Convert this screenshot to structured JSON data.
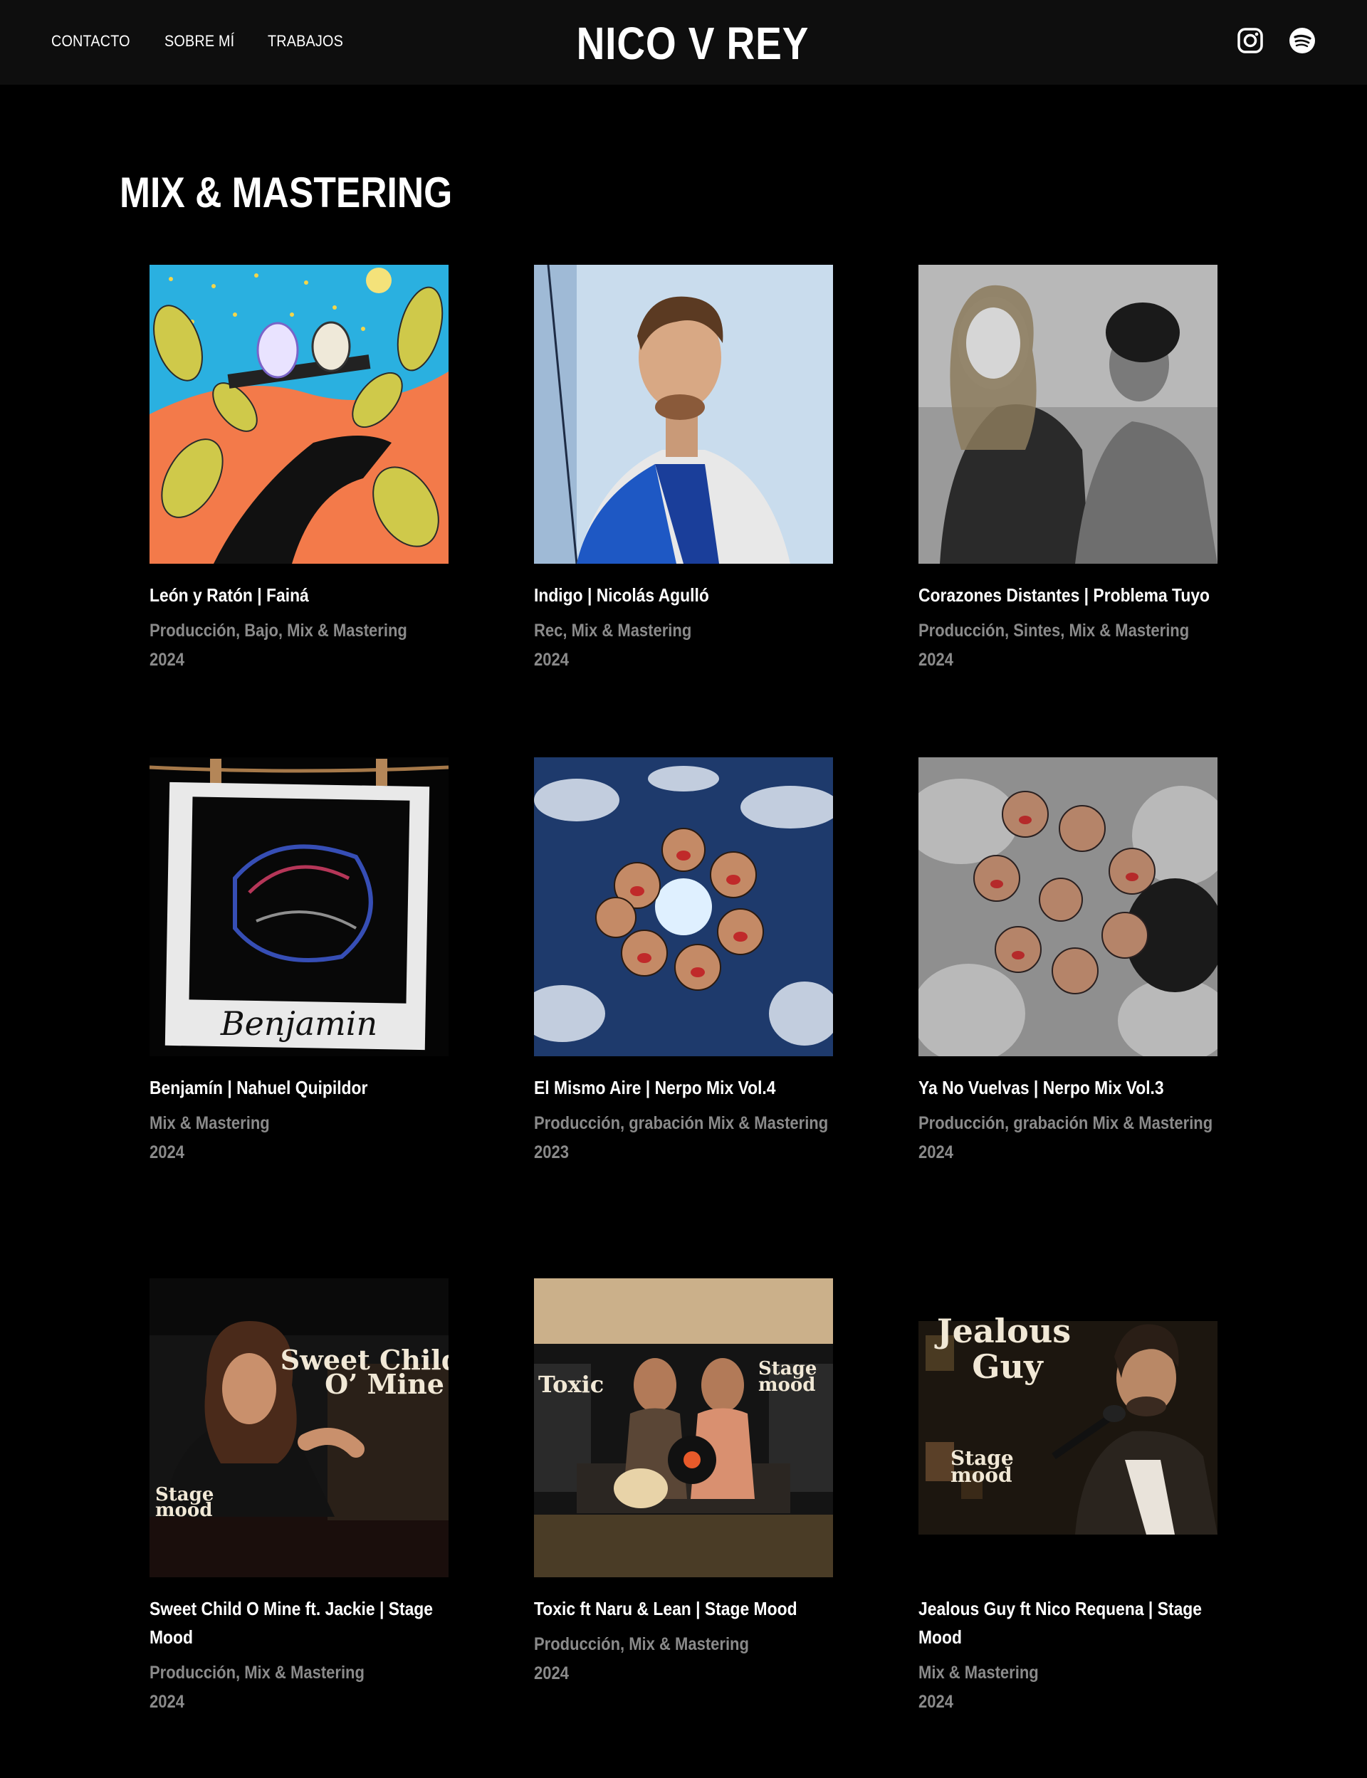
{
  "header": {
    "nav": [
      "CONTACTO",
      "SOBRE MÍ",
      "TRABAJOS"
    ],
    "brand": "NICO V REY",
    "social": [
      {
        "icon": "instagram-icon"
      },
      {
        "icon": "spotify-icon"
      }
    ]
  },
  "section": {
    "title": "MIX & MASTERING"
  },
  "works": [
    {
      "title": "León y Ratón | Fainá",
      "roles": "Producción, Bajo, Mix & Mastering",
      "year": "2024"
    },
    {
      "title": "Indigo | Nicolás Agulló",
      "roles": "Rec, Mix & Mastering",
      "year": "2024"
    },
    {
      "title": "Corazones Distantes | Problema Tuyo",
      "roles": "Producción, Sintes, Mix & Mastering",
      "year": "2024"
    },
    {
      "title": "Benjamín | Nahuel Quipildor",
      "roles": "Mix & Mastering",
      "year": "2024",
      "cover_text": "Benjamin"
    },
    {
      "title": "El Mismo Aire | Nerpo Mix Vol.4",
      "roles": "Producción, grabación Mix & Mastering",
      "year": "2023"
    },
    {
      "title": "Ya No Vuelvas | Nerpo Mix Vol.3",
      "roles": "Producción, grabación Mix & Mastering",
      "year": "2024"
    },
    {
      "title": "Sweet Child O Mine ft. Jackie | Stage Mood",
      "roles": "Producción, Mix & Mastering",
      "year": "2024",
      "cover_text": [
        "Sweet Child",
        "O’ Mine",
        "Stage",
        "mood"
      ]
    },
    {
      "title": "Toxic ft Naru & Lean | Stage Mood",
      "roles": "Producción, Mix & Mastering",
      "year": "2024",
      "cover_text": [
        "Toxic",
        "Stage",
        "mood"
      ]
    },
    {
      "title": "Jealous Guy ft Nico Requena | Stage Mood",
      "roles": "Mix & Mastering",
      "year": "2024",
      "cover_text": [
        "Jealous",
        "Guy",
        "Stage",
        "mood"
      ]
    }
  ],
  "colors": {
    "background": "#000000",
    "header_bg": "#0e0e0e",
    "text": "#ffffff",
    "muted": "#8a8a8a"
  }
}
